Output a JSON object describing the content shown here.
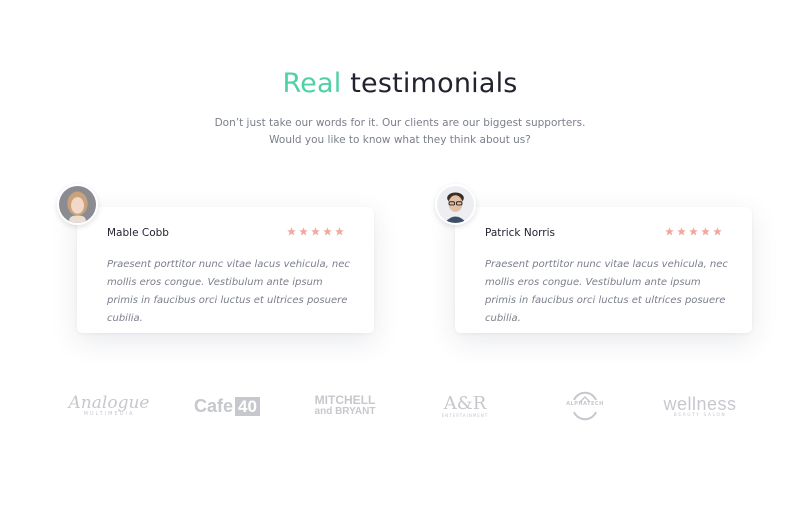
{
  "header": {
    "title_accent": "Real",
    "title_rest": "testimonials",
    "subtitle_line1": "Don’t just take our words for it. Our clients are our biggest supporters.",
    "subtitle_line2": "Would you like to know what they think about us?"
  },
  "testimonials": [
    {
      "name": "Mable Cobb",
      "rating": 5,
      "quote": "Praesent porttitor nunc vitae lacus vehicula, nec mollis eros congue. Vestibulum ante ipsum primis in faucibus orci luctus et ultrices posuere cubilia."
    },
    {
      "name": "Patrick Norris",
      "rating": 5,
      "quote": "Praesent porttitor nunc vitae lacus vehicula, nec mollis eros congue. Vestibulum ante ipsum primis in faucibus orci luctus et ultrices posuere cubilia."
    }
  ],
  "logos": [
    {
      "name": "Analogue",
      "sub": "MULTIMEDIA"
    },
    {
      "name": "Cafe",
      "badge": "40"
    },
    {
      "name": "MITCHELL",
      "sub": "and BRYANT"
    },
    {
      "name": "A&R",
      "sub": "ENTERTAINMENT"
    },
    {
      "name": "ALPHATECH"
    },
    {
      "name": "wellness",
      "sub": "BEAUTY SALON"
    }
  ],
  "colors": {
    "accent": "#4fd1a5",
    "star": "#f4a79c",
    "text_muted": "#7b7f8c",
    "logo_gray": "#c6c8ce"
  }
}
